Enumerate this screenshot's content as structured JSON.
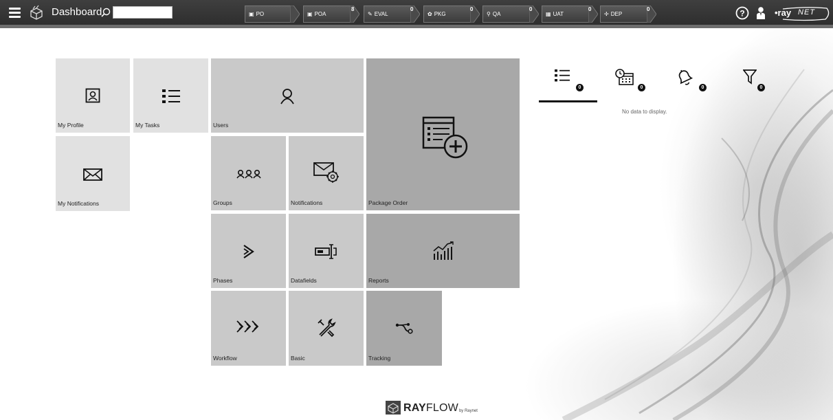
{
  "app": {
    "title": "Dashboard"
  },
  "search": {
    "placeholder": "",
    "value": ""
  },
  "phases": [
    {
      "label": "PO",
      "count": "",
      "icon": "po-icon"
    },
    {
      "label": "POA",
      "count": "8",
      "icon": "poa-icon"
    },
    {
      "label": "EVAL",
      "count": "0",
      "icon": "eval-icon"
    },
    {
      "label": "PKG",
      "count": "0",
      "icon": "pkg-icon"
    },
    {
      "label": "QA",
      "count": "0",
      "icon": "qa-icon"
    },
    {
      "label": "UAT",
      "count": "0",
      "icon": "uat-icon"
    },
    {
      "label": "DEP",
      "count": "0",
      "icon": "dep-icon"
    }
  ],
  "brand": {
    "prefix": "•ray",
    "suffix": "NET"
  },
  "tiles": {
    "my_profile": "My Profile",
    "my_tasks": "My Tasks",
    "users": "Users",
    "package_order": "Package Order",
    "my_notifications": "My Notifications",
    "groups": "Groups",
    "notifications": "Notifications",
    "phases": "Phases",
    "datafields": "Datafields",
    "reports": "Reports",
    "workflow": "Workflow",
    "basic": "Basic",
    "tracking": "Tracking"
  },
  "right_panel": {
    "tabs": [
      {
        "icon": "task-list-icon",
        "count": "0"
      },
      {
        "icon": "calendar-clock-icon",
        "count": "0"
      },
      {
        "icon": "bell-icon",
        "count": "0"
      },
      {
        "icon": "filter-icon",
        "count": "0"
      }
    ],
    "empty_text": "No data to display."
  },
  "footer": {
    "brand_bold": "RAY",
    "brand_thin": "FLOW",
    "byline": "by Raynet"
  },
  "colors": {
    "topbar": "#333333",
    "tile_light": "#e1e1e1",
    "tile_mid": "#c9c9c9",
    "tile_dark": "#a8a8a8"
  }
}
